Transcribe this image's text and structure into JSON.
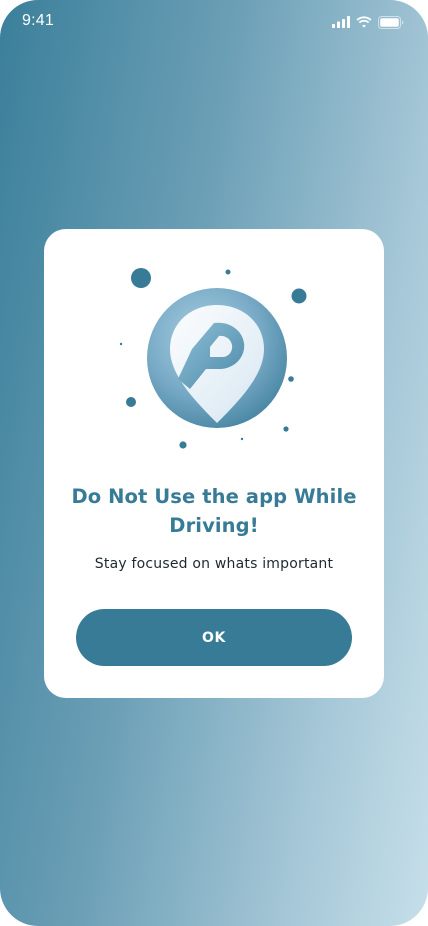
{
  "status_bar": {
    "time": "9:41",
    "icons": [
      "cellular-signal-icon",
      "wifi-icon",
      "battery-icon"
    ]
  },
  "dialog": {
    "illustration_icon": "parking-location-pin-icon",
    "title_lines": [
      "Do Not Use the app While",
      "Driving!"
    ],
    "subtitle": "Stay focused on whats important",
    "ok_label": "OK"
  },
  "colors": {
    "accent": "#377b96",
    "background_gradient": [
      "#3b7f9a",
      "#c6dfea"
    ],
    "card": "#ffffff"
  }
}
